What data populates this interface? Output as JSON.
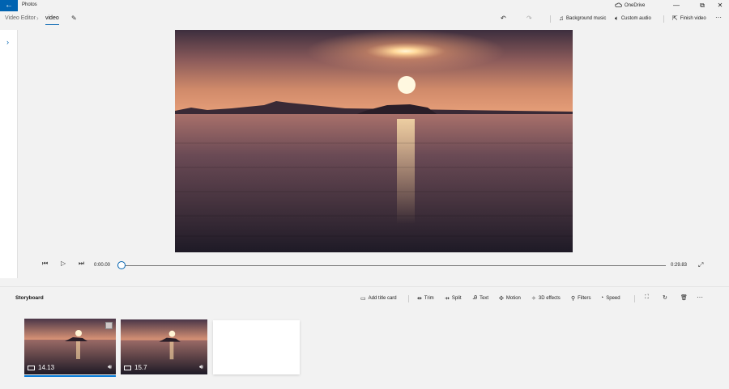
{
  "titlebar": {
    "back_icon": "←",
    "app_title": "Photos",
    "onedrive_label": "OneDrive",
    "minimize": "—",
    "maximize": "⧉",
    "close": "✕"
  },
  "breadcrumb": {
    "parent": "Video Editor",
    "separator": "›",
    "current": "video"
  },
  "header_actions": {
    "undo_icon": "↶",
    "redo_icon": "↷",
    "background_music": "Background music",
    "custom_audio": "Custom audio",
    "finish_video": "Finish video",
    "more": "···"
  },
  "side_panel": {
    "chevron": "›"
  },
  "player": {
    "current_time": "0:00.00",
    "total_time": "0:29.83",
    "progress": 0
  },
  "storyboard": {
    "title": "Storyboard",
    "tools": {
      "add_title_card": "Add title card",
      "trim": "Trim",
      "split": "Split",
      "text": "Text",
      "motion": "Motion",
      "effects_3d": "3D effects",
      "filters": "Filters",
      "speed": "Speed"
    },
    "more": "···",
    "clips": [
      {
        "duration": "14.13",
        "selected": true
      },
      {
        "duration": "15.7",
        "selected": false
      }
    ]
  },
  "colors": {
    "accent": "#0063b1",
    "selection": "#0078d7",
    "background": "#f2f2f2"
  }
}
